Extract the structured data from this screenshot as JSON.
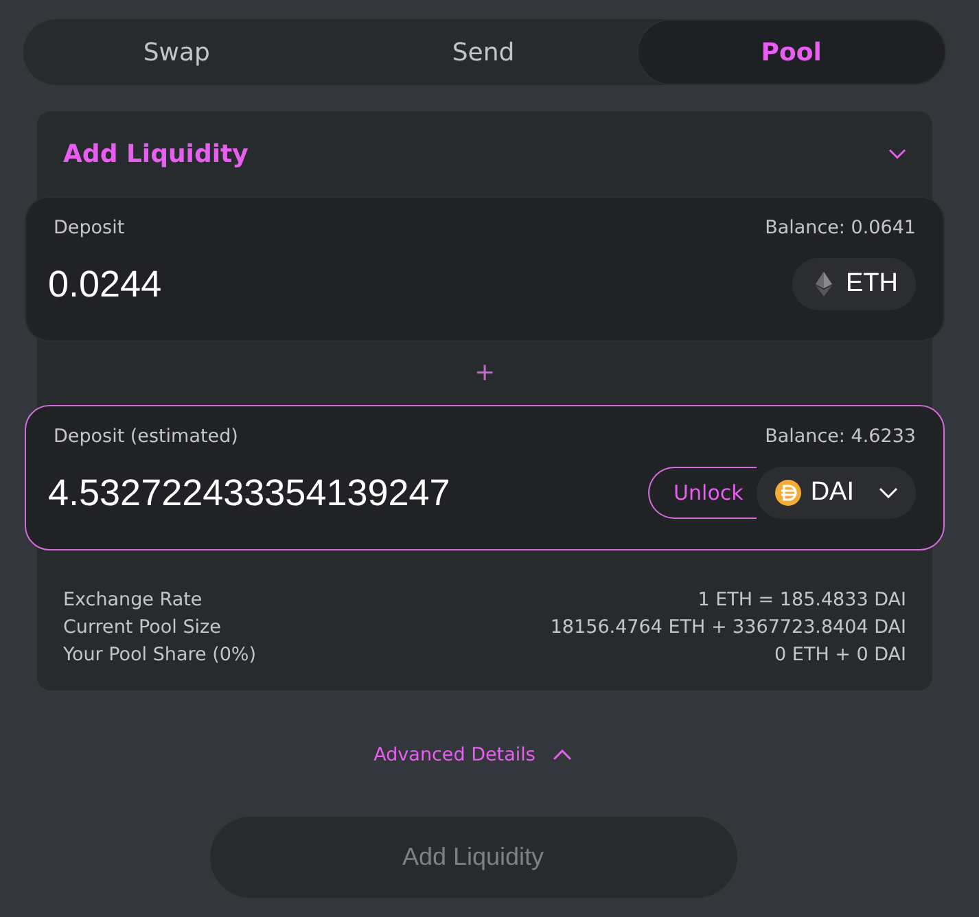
{
  "tabs": [
    {
      "label": "Swap",
      "selected": false
    },
    {
      "label": "Send",
      "selected": false
    },
    {
      "label": "Pool",
      "selected": true
    }
  ],
  "section": {
    "title": "Add Liquidity",
    "expanded": false
  },
  "inputs": [
    {
      "label": "Deposit",
      "balance": "Balance: 0.0641",
      "value": "0.0244",
      "token": "ETH",
      "kind": "eth",
      "focused": false
    },
    {
      "label": "Deposit (estimated)",
      "balance": "Balance: 4.6233",
      "value": "4.532722433354139247",
      "token": "DAI",
      "kind": "dai",
      "focused": true,
      "unlock": "Unlock"
    }
  ],
  "separator": "+",
  "details": [
    {
      "label": "Exchange Rate",
      "value": "1 ETH = 185.4833 DAI"
    },
    {
      "label": "Current Pool Size",
      "value": "18156.4764 ETH + 3367723.8404 DAI"
    },
    {
      "label": "Your Pool Share (0%)",
      "value": "0 ETH + 0 DAI"
    }
  ],
  "advanced": {
    "label": "Advanced Details",
    "expanded": true
  },
  "submit": {
    "label": "Add Liquidity",
    "disabled": true
  }
}
